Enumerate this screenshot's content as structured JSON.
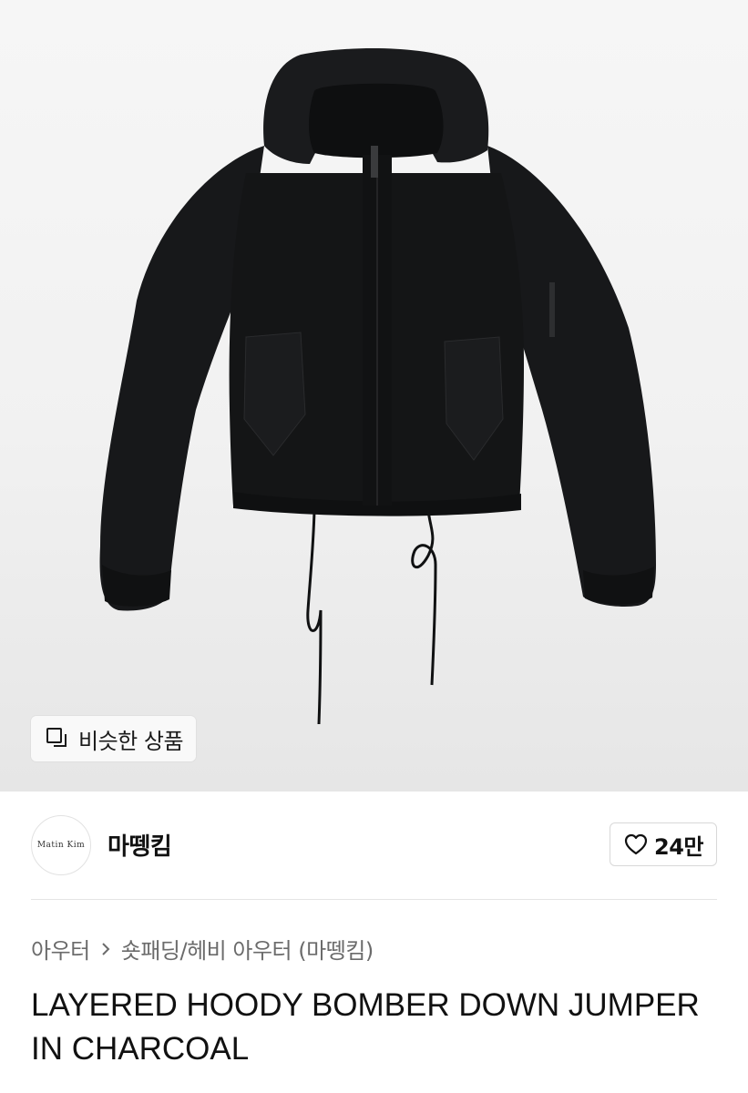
{
  "hero": {
    "image_alt": "LAYERED HOODY BOMBER DOWN JUMPER IN CHARCOAL",
    "similar_button": {
      "label": "비슷한 상품",
      "icon": "similar-items-icon"
    }
  },
  "seller": {
    "avatar_text": "Matin  Kim",
    "name": "마뗑킴",
    "like": {
      "icon": "heart-outline-icon",
      "count": "24만"
    }
  },
  "breadcrumb": {
    "category": "아우터",
    "separator_icon": "chevron-right-icon",
    "subcategory": "숏패딩/헤비 아우터 (마뗑킴)"
  },
  "product": {
    "title": "LAYERED HOODY BOMBER DOWN JUMPER IN CHARCOAL"
  },
  "colors": {
    "background": "#ffffff",
    "hero_bg": "#f1f1f1",
    "jacket": "#151617",
    "text_primary": "#111111",
    "text_secondary": "#6b6b6b",
    "border": "#d8d8d8"
  }
}
